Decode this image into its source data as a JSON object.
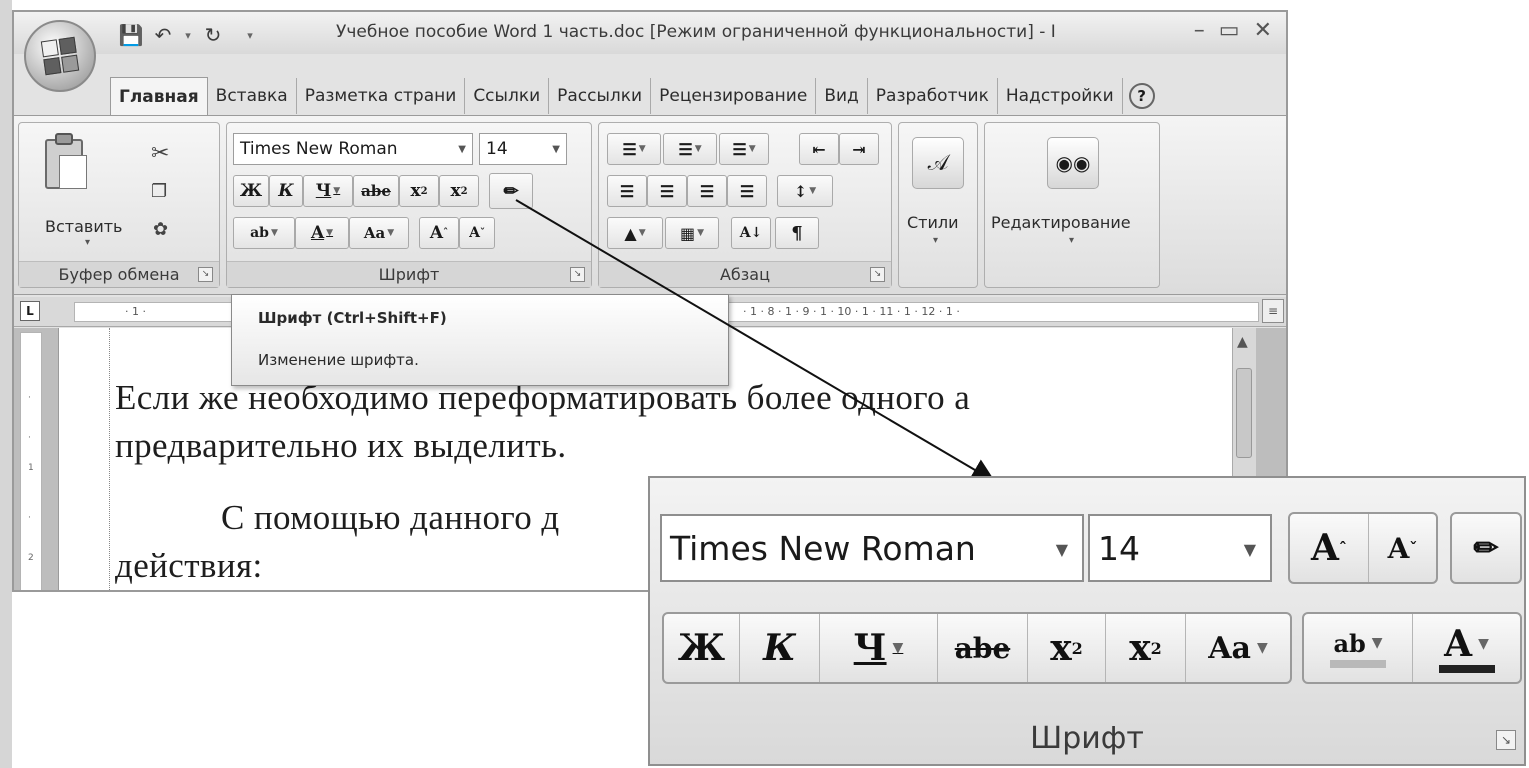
{
  "window": {
    "title": "Учебное пособие Word 1 часть.doc [Режим ограниченной функциональности] - I",
    "controls": [
      "–",
      "▭",
      "✕"
    ]
  },
  "quick_access": {
    "save_icon": "save-icon",
    "undo_icon": "undo-icon",
    "redo_icon": "redo-icon"
  },
  "tabs": [
    "Главная",
    "Вставка",
    "Разметка страни",
    "Ссылки",
    "Рассылки",
    "Рецензирование",
    "Вид",
    "Разработчик",
    "Надстройки"
  ],
  "ribbon": {
    "clipboard": {
      "paste_label": "Вставить",
      "group_label": "Буфер обмена"
    },
    "font": {
      "font_name": "Times New Roman",
      "font_size": "14",
      "bold": "Ж",
      "italic": "К",
      "underline": "Ч",
      "strike": "abe",
      "subscript": "x",
      "superscript": "x",
      "change_case": "Aa",
      "grow": "A",
      "shrink": "A",
      "highlight": "ab",
      "font_color": "A",
      "group_label": "Шрифт"
    },
    "paragraph": {
      "group_label": "Абзац"
    },
    "styles": {
      "label": "Стили"
    },
    "editing": {
      "label": "Редактирование"
    }
  },
  "ruler": {
    "marks": [
      "· 1 · ",
      "· 1 · 8 · 1 · 9 · 1 · 10 · 1 · 11 · 1 · 12 · 1 ·"
    ]
  },
  "tooltip": {
    "title": "Шрифт (Ctrl+Shift+F)",
    "description": "Изменение шрифта."
  },
  "document": {
    "line1": "Если же необходимо переформатировать более одного а",
    "line2": "предварительно их выделить.",
    "line3": "С помощью данного д",
    "line4": "действия:"
  },
  "zoom_panel": {
    "font_name": "Times New Roman",
    "font_size": "14",
    "bold": "Ж",
    "italic": "К",
    "underline": "Ч",
    "strike": "abe",
    "subscript": "x",
    "sub_digit": "2",
    "superscript": "x",
    "sup_digit": "2",
    "change_case": "Aa",
    "grow": "A",
    "shrink": "A",
    "highlight": "ab",
    "font_color": "A",
    "group_label": "Шрифт"
  }
}
